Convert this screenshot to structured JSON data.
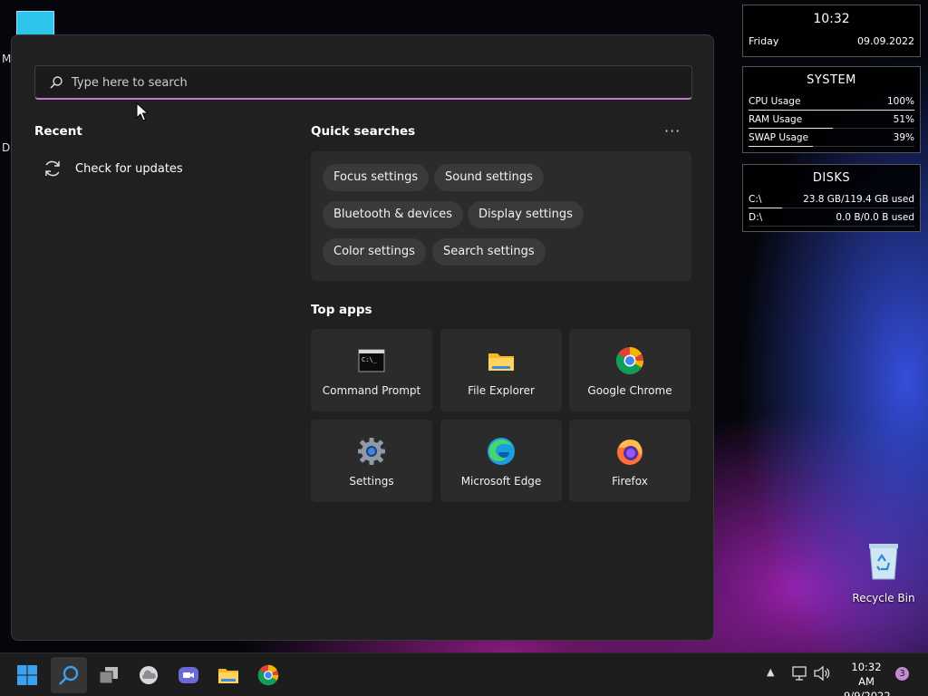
{
  "desktop": {
    "side_letters": [
      "M",
      "Da"
    ],
    "recycle_bin_label": "Recycle Bin"
  },
  "widgets": {
    "clock": {
      "time": "10:32",
      "day": "Friday",
      "date": "09.09.2022"
    },
    "system": {
      "title": "SYSTEM",
      "rows": [
        {
          "label": "CPU Usage",
          "value": "100%",
          "level": 1.0
        },
        {
          "label": "RAM Usage",
          "value": "51%",
          "level": 0.51
        },
        {
          "label": "SWAP Usage",
          "value": "39%",
          "level": 0.39
        }
      ]
    },
    "disks": {
      "title": "DISKS",
      "rows": [
        {
          "label": "C:\\",
          "value": "23.8 GB/119.4 GB used",
          "level": 0.2
        },
        {
          "label": "D:\\",
          "value": "0.0 B/0.0 B used",
          "level": 0.0
        }
      ]
    }
  },
  "search": {
    "placeholder": "Type here to search",
    "recent_heading": "Recent",
    "recent_items": [
      {
        "label": "Check for updates",
        "icon": "refresh-icon"
      }
    ],
    "quick_heading": "Quick searches",
    "more_label": "···",
    "quick_searches": [
      "Focus settings",
      "Sound settings",
      "Bluetooth & devices",
      "Display settings",
      "Color settings",
      "Search settings"
    ],
    "top_apps_heading": "Top apps",
    "top_apps": [
      {
        "label": "Command Prompt",
        "icon": "command-prompt-icon"
      },
      {
        "label": "File Explorer",
        "icon": "file-explorer-icon"
      },
      {
        "label": "Google Chrome",
        "icon": "chrome-icon"
      },
      {
        "label": "Settings",
        "icon": "settings-gear-icon"
      },
      {
        "label": "Microsoft Edge",
        "icon": "edge-icon"
      },
      {
        "label": "Firefox",
        "icon": "firefox-icon"
      }
    ]
  },
  "taskbar": {
    "time": "10:32 AM",
    "date": "9/9/2022",
    "notification_count": "3",
    "accent_color": "#c27bc7"
  }
}
